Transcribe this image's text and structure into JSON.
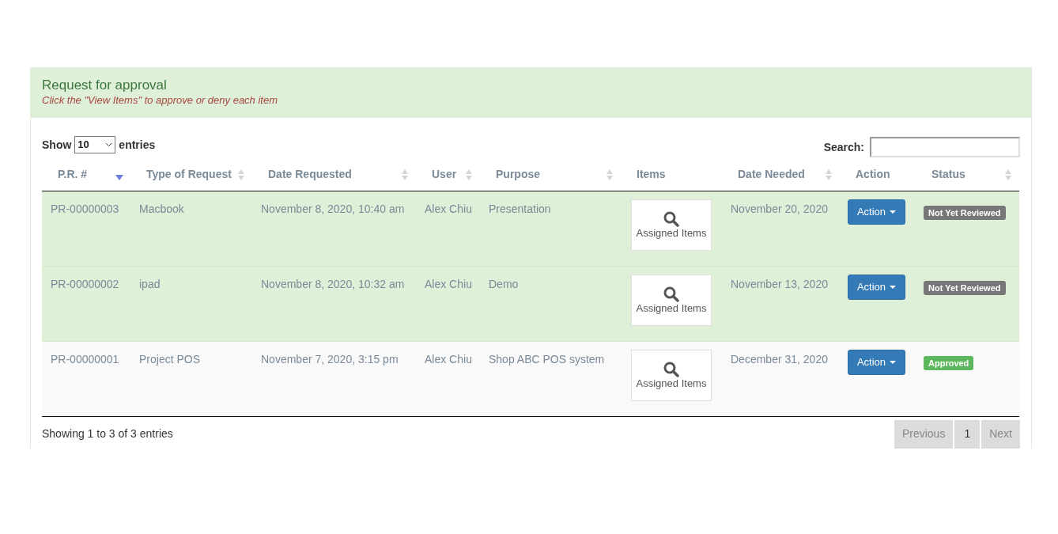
{
  "panel": {
    "title": "Request for approval",
    "subtitle": "Click the \"View Items\" to approve or deny each item"
  },
  "length_control": {
    "label_before": "Show",
    "value": "10",
    "label_after": "entries"
  },
  "search": {
    "label": "Search:"
  },
  "table": {
    "columns": [
      {
        "label": "P.R. #",
        "kind": "sorted"
      },
      {
        "label": "Type of Request",
        "kind": "sortable"
      },
      {
        "label": "Date Requested",
        "kind": "sortable"
      },
      {
        "label": "User",
        "kind": "sortable"
      },
      {
        "label": "Purpose",
        "kind": "sortable"
      },
      {
        "label": "Items",
        "kind": "plain"
      },
      {
        "label": "Date Needed",
        "kind": "sortable"
      },
      {
        "label": "Action",
        "kind": "plain"
      },
      {
        "label": "Status",
        "kind": "sortable"
      }
    ],
    "rows": [
      {
        "pr": "PR-00000003",
        "type": "Macbook",
        "date_requested": "November 8, 2020, 10:40 am",
        "user": "Alex Chiu",
        "purpose": "Presentation",
        "items": "Assigned Items",
        "date_needed": "November 20, 2020",
        "action": "Action",
        "status": {
          "label": "Not Yet Reviewed",
          "kind": "pending"
        },
        "highlighted": true
      },
      {
        "pr": "PR-00000002",
        "type": "ipad",
        "date_requested": "November 8, 2020, 10:32 am",
        "user": "Alex Chiu",
        "purpose": "Demo",
        "items": "Assigned Items",
        "date_needed": "November 13, 2020",
        "action": "Action",
        "status": {
          "label": "Not Yet Reviewed",
          "kind": "pending"
        },
        "highlighted": true
      },
      {
        "pr": "PR-00000001",
        "type": "Project POS",
        "date_requested": "November 7, 2020, 3:15 pm",
        "user": "Alex Chiu",
        "purpose": "Shop ABC POS system",
        "items": "Assigned Items",
        "date_needed": "December 31, 2020",
        "action": "Action",
        "status": {
          "label": "Approved",
          "kind": "approved"
        },
        "highlighted": false
      }
    ]
  },
  "info": "Showing 1 to 3 of 3 entries",
  "pagination": [
    {
      "label": "Previous",
      "selected": false
    },
    {
      "label": "1",
      "selected": true
    },
    {
      "label": "Next",
      "selected": false
    }
  ]
}
